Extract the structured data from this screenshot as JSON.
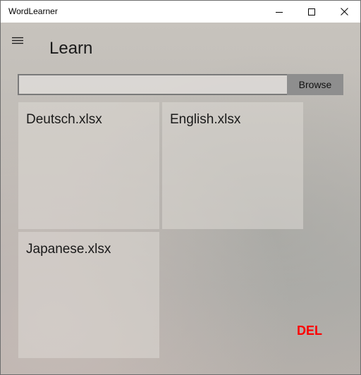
{
  "window": {
    "title": "WordLearner",
    "controls": {
      "minimize_icon": "minimize-icon",
      "maximize_icon": "maximize-icon",
      "close_icon": "close-icon"
    }
  },
  "header": {
    "menu_icon": "hamburger-menu-icon",
    "title": "Learn"
  },
  "file_picker": {
    "path_value": "",
    "browse_label": "Browse"
  },
  "files": [
    {
      "name": "Deutsch.xlsx"
    },
    {
      "name": "English.xlsx"
    },
    {
      "name": "Japanese.xlsx"
    }
  ],
  "actions": {
    "delete_label": "DEL",
    "delete_color": "#ff0000"
  }
}
